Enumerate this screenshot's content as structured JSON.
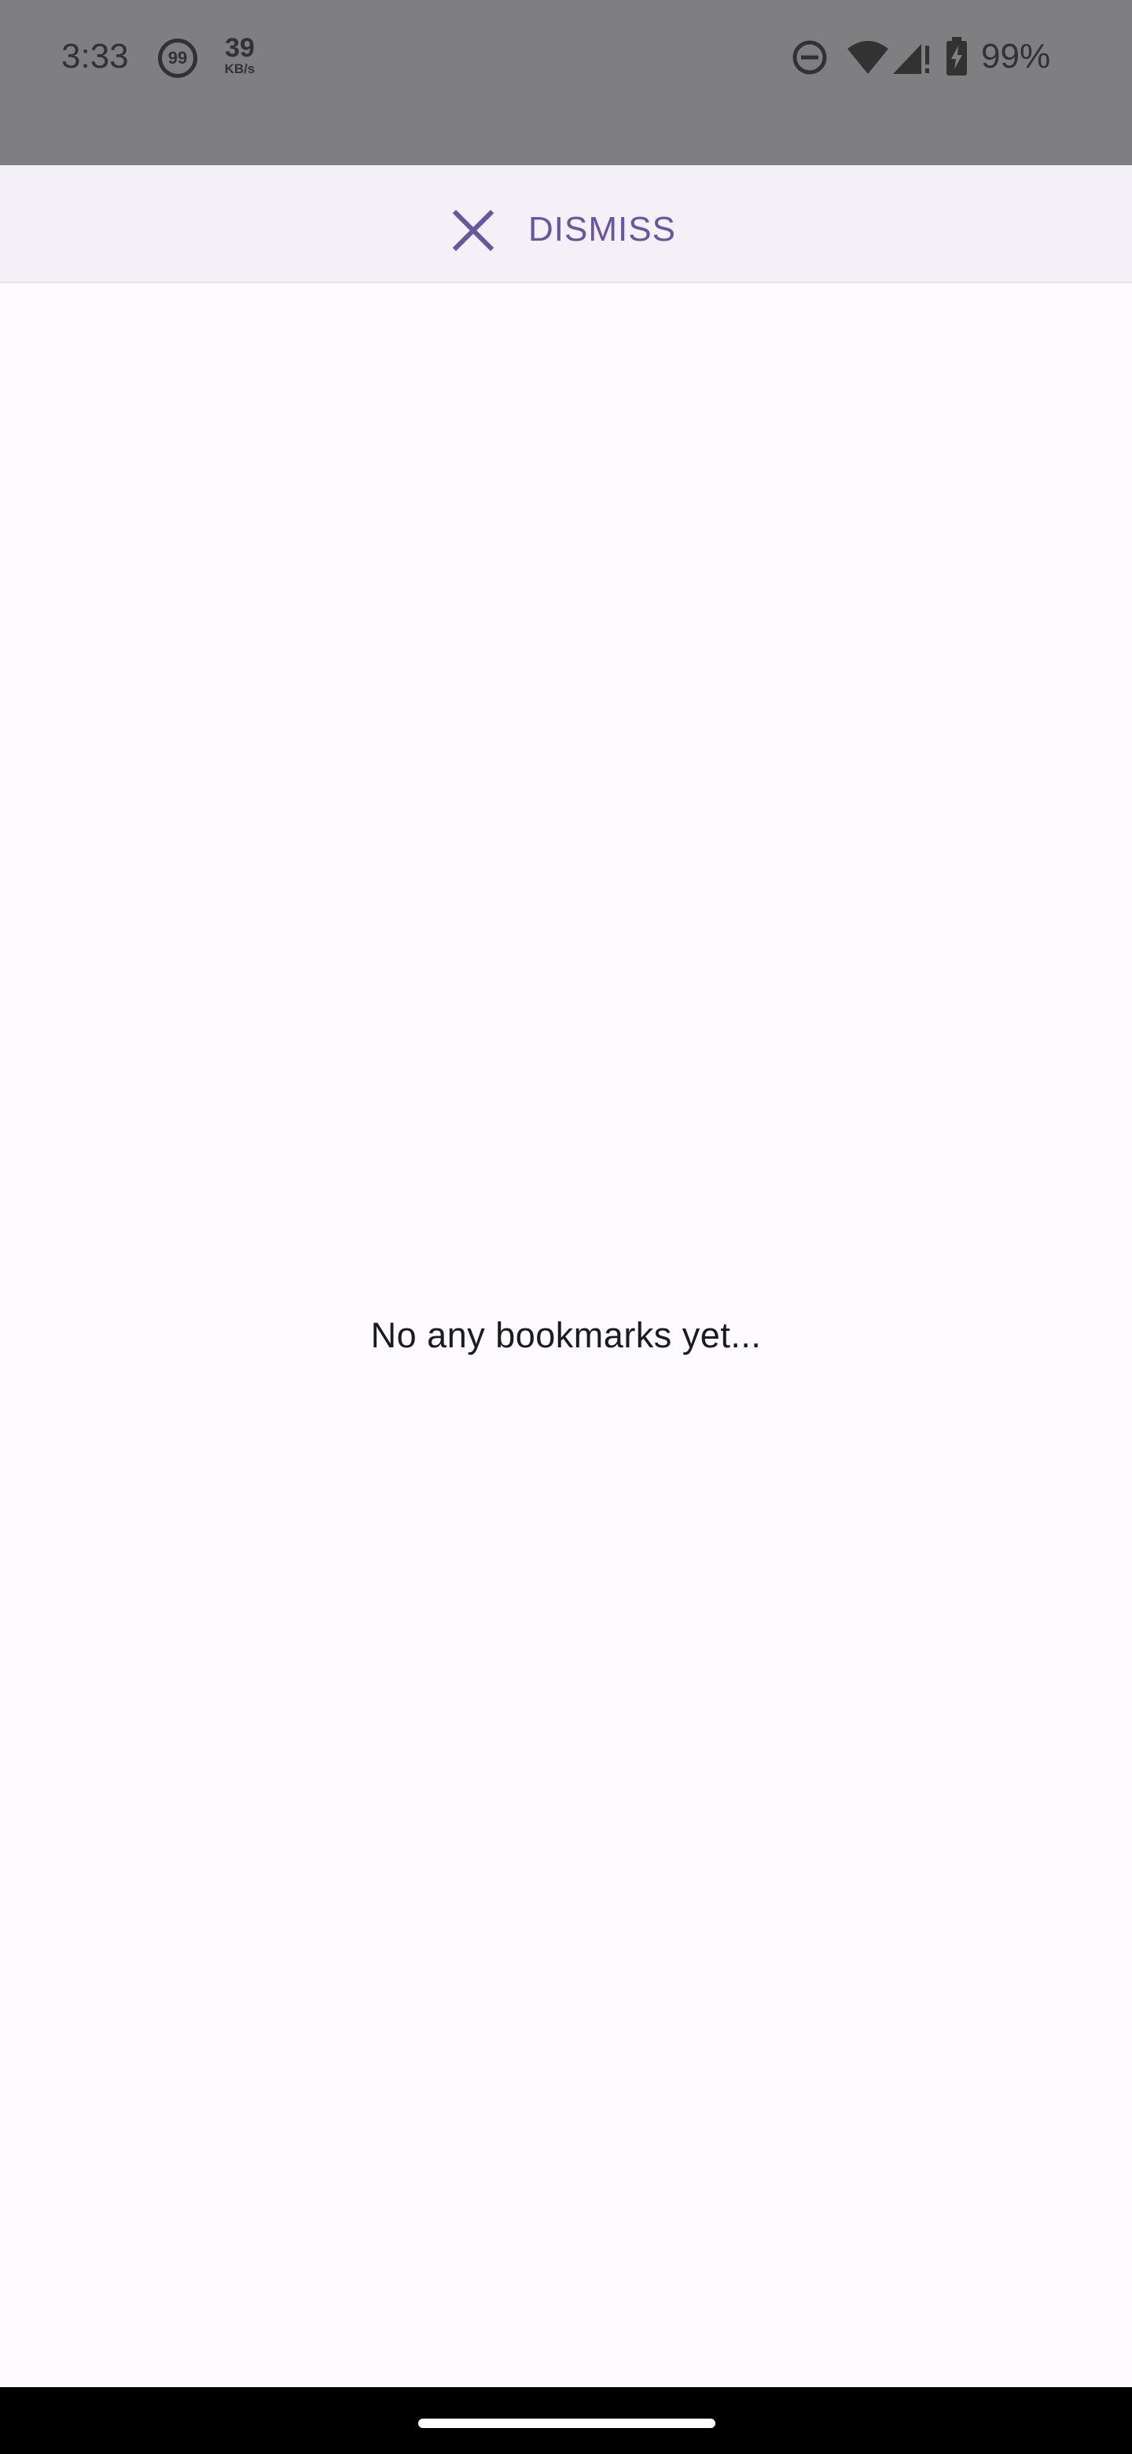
{
  "status_bar": {
    "time": "3:33",
    "notification_count": "99",
    "net_speed_value": "39",
    "net_speed_unit": "KB/s",
    "battery_percent": "99%",
    "icons": [
      "dnd-icon",
      "wifi-icon",
      "cell-signal-icon",
      "battery-charging-icon"
    ]
  },
  "top_bar": {
    "dismiss_label": "DISMISS",
    "dismiss_icon": "close-icon",
    "accent_color": "#6a55a0"
  },
  "main": {
    "empty_message": "No any bookmarks yet..."
  },
  "colors": {
    "status_bar_bg": "#7f7e81",
    "top_bar_bg": "#f3f1f7",
    "page_bg": "#fdfbfe",
    "nav_bar_bg": "#000000"
  }
}
